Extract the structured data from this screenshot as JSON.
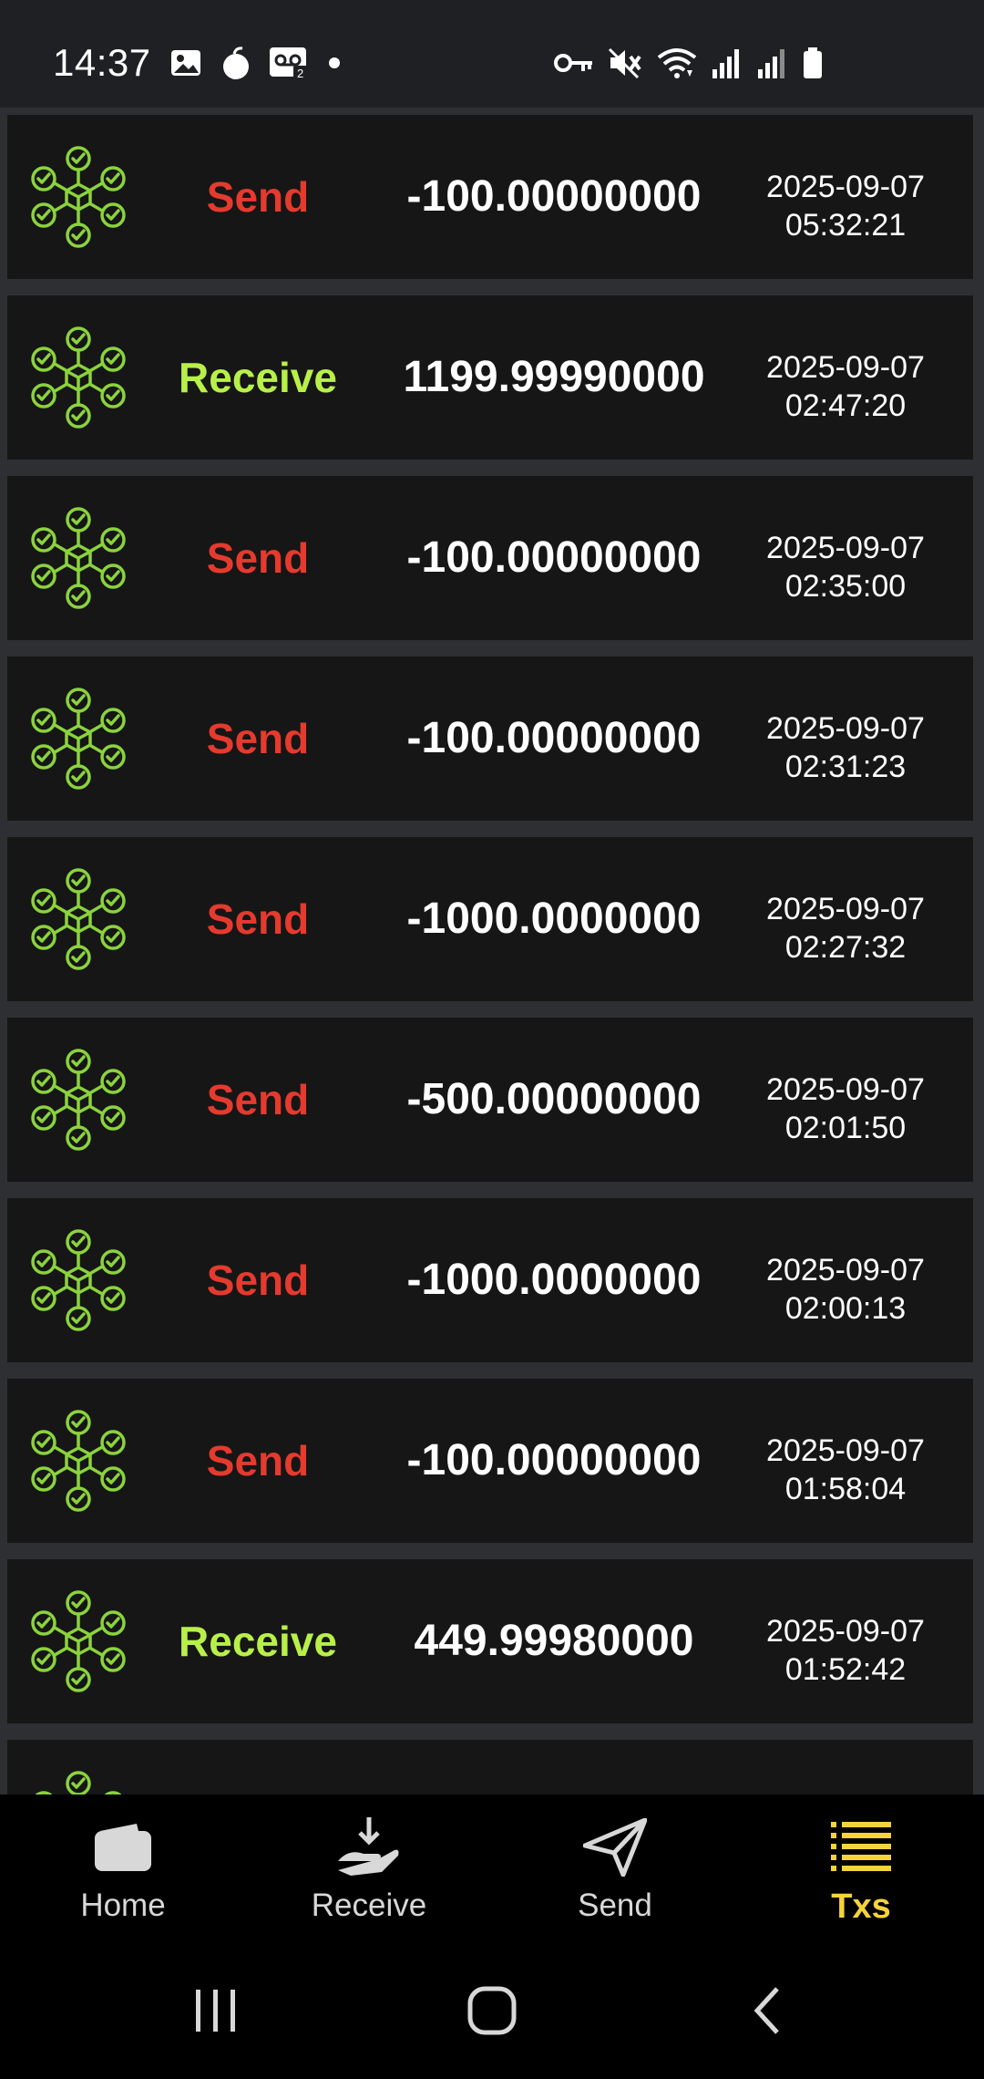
{
  "status_bar": {
    "time": "14:37",
    "left_icons": [
      "gallery-icon",
      "notification-app-icon",
      "voicemail-icon",
      "dot-icon"
    ],
    "right_icons": [
      "vpn-key-icon",
      "mute-icon",
      "wifi-icon",
      "signal-icon",
      "signal-icon-2",
      "battery-icon"
    ]
  },
  "colors": {
    "send": "#e53a2e",
    "receive": "#b8f049",
    "active_tab": "#f5d33a",
    "icon_green": "#8bd33d"
  },
  "transactions": [
    {
      "type": "Send",
      "amount": "-100.00000000",
      "date": "2025-09-07",
      "time": "05:32:21"
    },
    {
      "type": "Receive",
      "amount": "1199.99990000",
      "date": "2025-09-07",
      "time": "02:47:20"
    },
    {
      "type": "Send",
      "amount": "-100.00000000",
      "date": "2025-09-07",
      "time": "02:35:00"
    },
    {
      "type": "Send",
      "amount": "-100.00000000",
      "date": "2025-09-07",
      "time": "02:31:23"
    },
    {
      "type": "Send",
      "amount": "-1000.0000000",
      "date": "2025-09-07",
      "time": "02:27:32"
    },
    {
      "type": "Send",
      "amount": "-500.00000000",
      "date": "2025-09-07",
      "time": "02:01:50"
    },
    {
      "type": "Send",
      "amount": "-1000.0000000",
      "date": "2025-09-07",
      "time": "02:00:13"
    },
    {
      "type": "Send",
      "amount": "-100.00000000",
      "date": "2025-09-07",
      "time": "01:58:04"
    },
    {
      "type": "Receive",
      "amount": "449.99980000",
      "date": "2025-09-07",
      "time": "01:52:42"
    },
    {
      "type": "",
      "amount": "",
      "date": "",
      "time": ""
    }
  ],
  "bottom_nav": {
    "home": {
      "label": "Home",
      "icon": "wallet-icon"
    },
    "receive": {
      "label": "Receive",
      "icon": "receive-hand-icon"
    },
    "send": {
      "label": "Send",
      "icon": "paper-plane-icon"
    },
    "txs": {
      "label": "Txs",
      "icon": "list-icon",
      "active": true
    }
  },
  "system_nav": [
    "recents-icon",
    "home-circle-icon",
    "back-icon"
  ]
}
